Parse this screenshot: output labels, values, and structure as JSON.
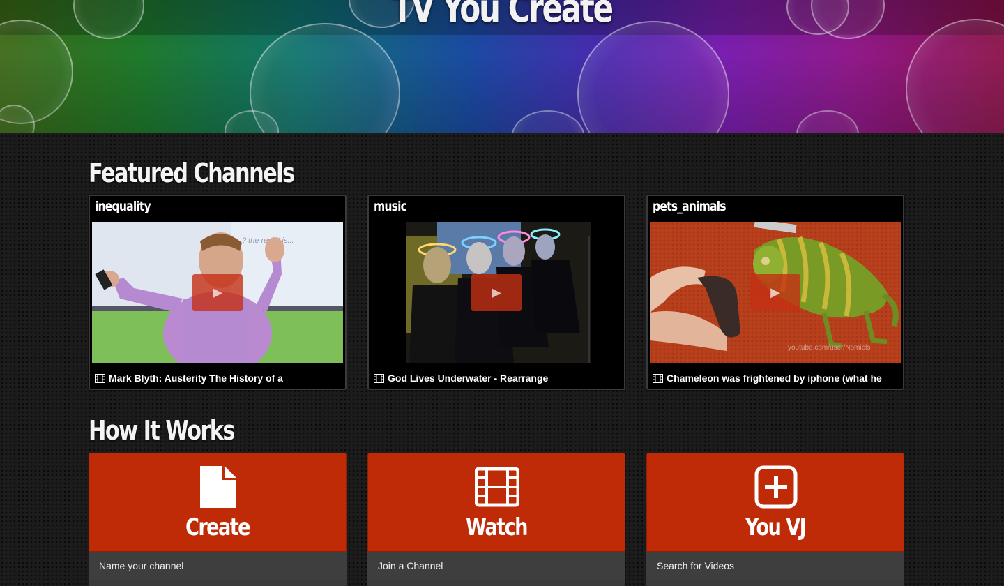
{
  "site": {
    "title": "TV You Create"
  },
  "featured": {
    "heading": "Featured Channels",
    "channels": [
      {
        "name": "inequality",
        "video_title": "Mark Blyth: Austerity The History of a"
      },
      {
        "name": "music",
        "video_title": "God Lives Underwater - Rearrange"
      },
      {
        "name": "pets_animals",
        "video_title": "Chameleon was frightened by iphone (what he",
        "watermark": "youtube.com/user/Nomiels"
      }
    ]
  },
  "how_it_works": {
    "heading": "How It Works",
    "steps": [
      {
        "title": "Create",
        "icon": "document-icon",
        "item": "Name your channel"
      },
      {
        "title": "Watch",
        "icon": "film-icon",
        "item": "Join a Channel"
      },
      {
        "title": "You VJ",
        "icon": "plus-square-icon",
        "item": "Search for Videos"
      }
    ]
  },
  "colors": {
    "accent": "#bf2a07",
    "background": "#1c1c1c",
    "panel": "#3e3e3e"
  }
}
